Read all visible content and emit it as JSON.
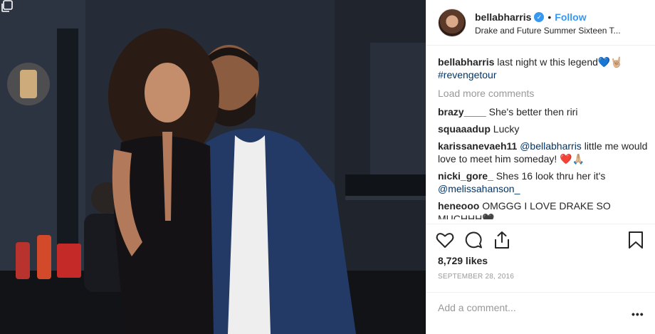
{
  "post": {
    "author": {
      "username": "bellabharris",
      "verified_icon": "verified-badge-icon",
      "follow_label": "Follow",
      "separator": "•",
      "location": "Drake and Future Summer Sixteen T..."
    },
    "caption": {
      "username": "bellabharris",
      "text": "last night w this legend",
      "emojis": "💙🤘🏼",
      "hashtag": "#revengetour"
    },
    "load_more_label": "Load more comments",
    "comments": [
      {
        "username": "brazy____",
        "text": "She's better then riri"
      },
      {
        "username": "squaaadup",
        "text": "Lucky"
      },
      {
        "username": "karissanevaeh11",
        "mention": "@bellabharris",
        "text": "little me would love to meet him someday!",
        "emojis": "❤️🙏🏼"
      },
      {
        "username": "nicki_gore_",
        "text": "Shes 16 look thru her it's",
        "mention": "@melissahanson_"
      },
      {
        "username": "heneooo",
        "text": "OMGGG I LOVE DRAKE SO MUCHHH",
        "emojis": "🖤"
      }
    ],
    "likes": "8,729 likes",
    "date": "SEPTEMBER 28, 2016",
    "add_comment_placeholder": "Add a comment...",
    "more_label": "•••",
    "icons": {
      "like": "heart-icon",
      "comment": "comment-icon",
      "share": "share-icon",
      "save": "bookmark-icon",
      "multi": "multiple-photos-icon"
    },
    "colors": {
      "link": "#003569",
      "accent": "#3897f0",
      "muted": "#999999",
      "text": "#262626"
    }
  }
}
